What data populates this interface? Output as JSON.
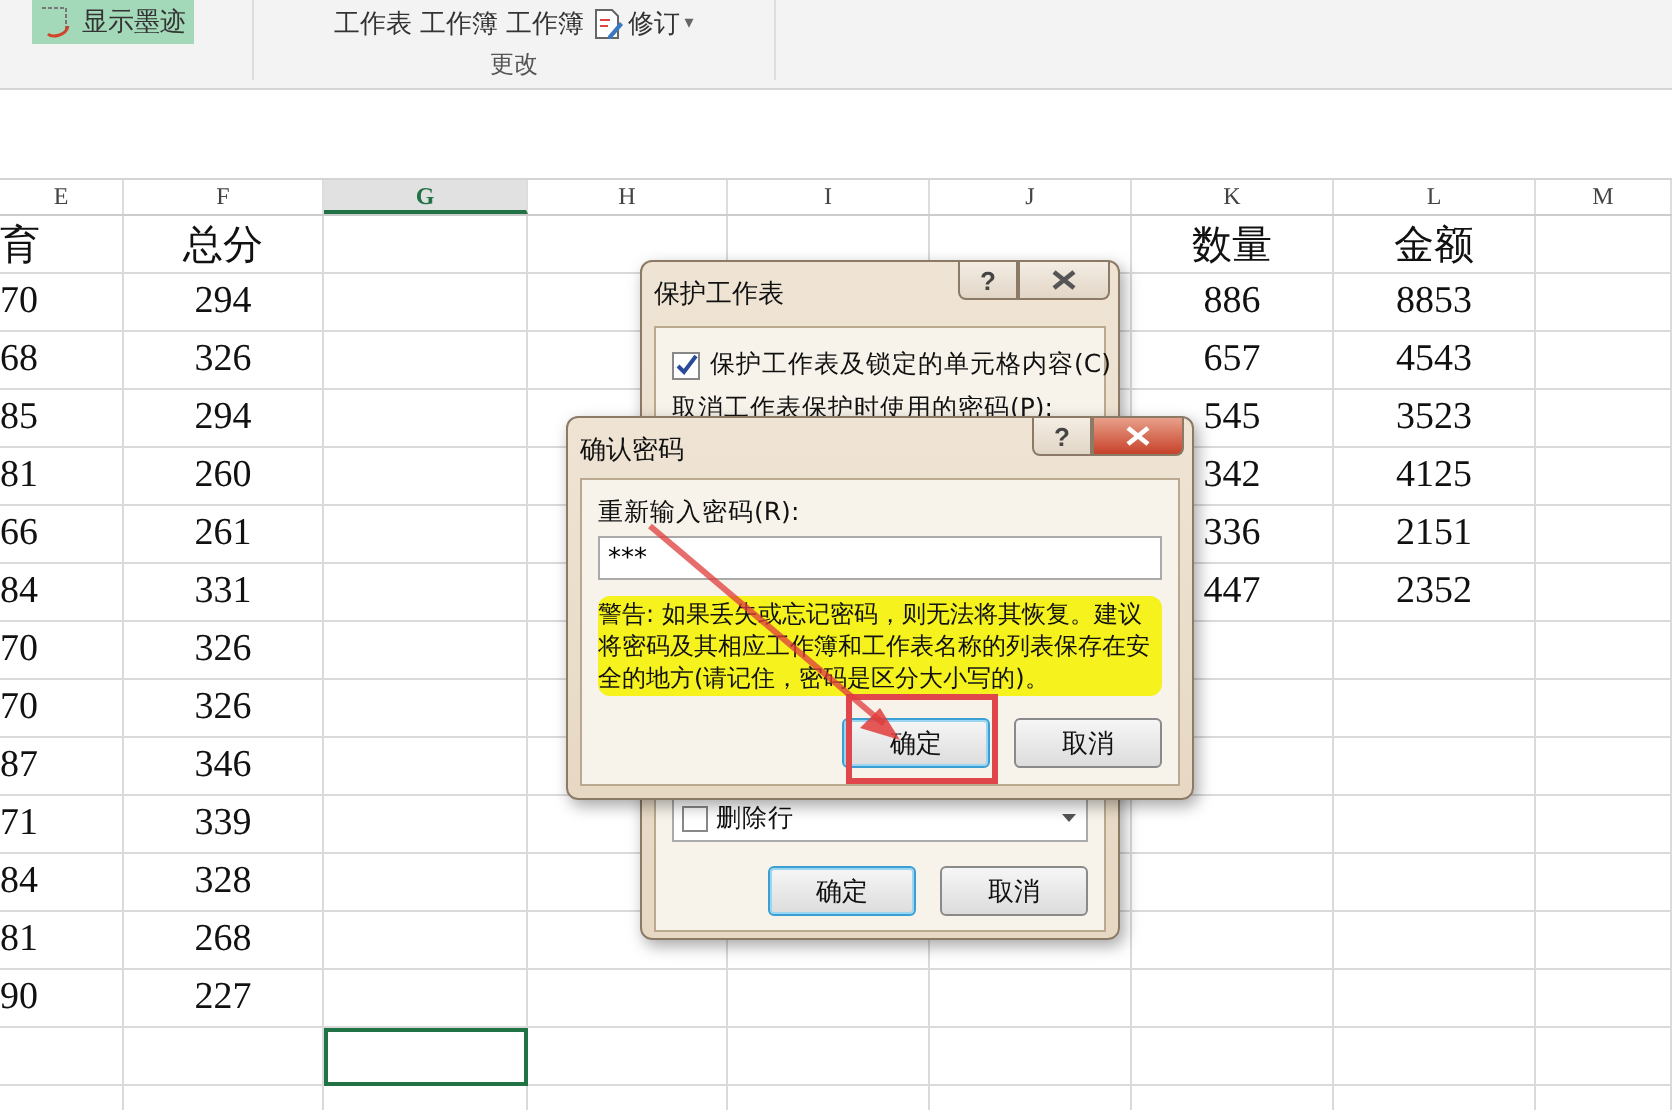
{
  "ribbon": {
    "ink_button": {
      "label": "显示墨迹",
      "selected": true
    },
    "buttons": [
      {
        "label": "工作表"
      },
      {
        "label": "工作簿"
      },
      {
        "label": "工作簿"
      }
    ],
    "track_changes": {
      "label": "修订",
      "caret": "▾"
    },
    "group_label": "更改"
  },
  "sheet": {
    "columns": [
      {
        "label": "E",
        "selected": false
      },
      {
        "label": "F",
        "selected": false
      },
      {
        "label": "G",
        "selected": true
      },
      {
        "label": "H",
        "selected": false
      },
      {
        "label": "I",
        "selected": false
      },
      {
        "label": "J",
        "selected": false
      },
      {
        "label": "K",
        "selected": false
      },
      {
        "label": "L",
        "selected": false
      },
      {
        "label": "M",
        "selected": false
      }
    ],
    "rows": [
      {
        "selected": false,
        "cells": {
          "E": "育",
          "F": "总分",
          "K": "数量",
          "L": "金额"
        }
      },
      {
        "selected": false,
        "cells": {
          "E": "70",
          "F": "294",
          "K": "886",
          "L": "8853"
        }
      },
      {
        "selected": false,
        "cells": {
          "E": "68",
          "F": "326",
          "K": "657",
          "L": "4543"
        }
      },
      {
        "selected": false,
        "cells": {
          "E": "85",
          "F": "294",
          "K": "545",
          "L": "3523"
        }
      },
      {
        "selected": false,
        "cells": {
          "E": "81",
          "F": "260",
          "K": "342",
          "L": "4125"
        }
      },
      {
        "selected": false,
        "cells": {
          "E": "66",
          "F": "261",
          "K": "336",
          "L": "2151"
        }
      },
      {
        "selected": false,
        "cells": {
          "E": "84",
          "F": "331",
          "K": "447",
          "L": "2352"
        }
      },
      {
        "selected": false,
        "cells": {
          "E": "70",
          "F": "326"
        }
      },
      {
        "selected": false,
        "cells": {
          "E": "70",
          "F": "326"
        }
      },
      {
        "selected": false,
        "cells": {
          "E": "87",
          "F": "346"
        }
      },
      {
        "selected": false,
        "cells": {
          "E": "71",
          "F": "339"
        }
      },
      {
        "selected": false,
        "cells": {
          "E": "84",
          "F": "328"
        }
      },
      {
        "selected": false,
        "cells": {
          "E": "81",
          "F": "268"
        }
      },
      {
        "selected": false,
        "cells": {
          "E": "90",
          "F": "227"
        }
      },
      {
        "selected": true,
        "cells": {}
      },
      {
        "selected": false,
        "cells": {}
      }
    ]
  },
  "protect_dialog": {
    "title": "保护工作表",
    "help": "?",
    "checkbox": {
      "label": "保护工作表及锁定的单元格内容(C)",
      "checked": true
    },
    "password_label": "取消工作表保护时使用的密码(P):",
    "list_items": [
      {
        "label": "删除行",
        "checked": false
      }
    ],
    "buttons": [
      {
        "label": "确定",
        "selected": true
      },
      {
        "label": "取消",
        "selected": false
      }
    ]
  },
  "confirm_dialog": {
    "title": "确认密码",
    "help": "?",
    "field_label": "重新输入密码(R):",
    "value": "***",
    "warning": "警告: 如果丢失或忘记密码，则无法将其恢复。建议将密码及其相应工作簿和工作表名称的列表保存在安全的地方(请记住，密码是区分大小写的)。",
    "buttons": [
      {
        "label": "确定",
        "selected": true
      },
      {
        "label": "取消",
        "selected": false
      }
    ]
  }
}
